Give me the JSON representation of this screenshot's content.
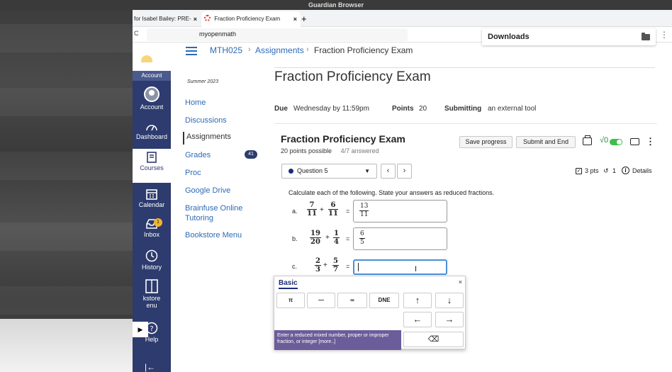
{
  "os": {
    "window_title": "Guardian Browser"
  },
  "tabs": [
    {
      "label": "for Isabel Bailey: PRE-"
    },
    {
      "label": "Fraction Proficiency Exam"
    }
  ],
  "address": {
    "url": "myopenmath"
  },
  "downloads": {
    "label": "Downloads"
  },
  "rail": {
    "account_top": "Account",
    "items": [
      {
        "label": "Account"
      },
      {
        "label": "Dashboard"
      },
      {
        "label": "Courses"
      },
      {
        "label": "Calendar"
      },
      {
        "label": "Inbox",
        "badge": "1"
      },
      {
        "label": "History"
      },
      {
        "label": "kstore",
        "label2": "enu"
      },
      {
        "label": "Help"
      }
    ]
  },
  "breadcrumb": {
    "course": "MTH025",
    "section": "Assignments",
    "current": "Fraction Proficiency Exam"
  },
  "course_nav": {
    "term": "Summer 2023",
    "items": [
      {
        "label": "Home"
      },
      {
        "label": "Discussions"
      },
      {
        "label": "Assignments"
      },
      {
        "label": "Grades",
        "badge": "41"
      },
      {
        "label": "Proc"
      },
      {
        "label": "Google Drive"
      },
      {
        "label": "Brainfuse Online",
        "label2": "Tutoring"
      },
      {
        "label": "Bookstore Menu"
      }
    ]
  },
  "assignment": {
    "title": "Fraction Proficiency Exam",
    "due_label": "Due",
    "due_value": "Wednesday by 11:59pm",
    "points_label": "Points",
    "points_value": "20",
    "submitting_label": "Submitting",
    "submitting_value": "an external tool"
  },
  "exam": {
    "title": "Fraction Proficiency Exam",
    "points_possible": "20 points possible",
    "answered": "4/7 answered",
    "save_label": "Save progress",
    "submit_label": "Submit and End",
    "sqrt_label": "√0",
    "question_label": "Question 5",
    "pts": "3 pts",
    "retries": "1",
    "details": "Details"
  },
  "question": {
    "instruction": "Calculate each of the following. State your answers as reduced fractions.",
    "parts": [
      {
        "letter": "a.",
        "n1": "7",
        "d1": "11",
        "n2": "6",
        "d2": "11",
        "ans_n": "13",
        "ans_d": "11"
      },
      {
        "letter": "b.",
        "n1": "19",
        "d1": "20",
        "n2": "1",
        "d2": "4",
        "ans_n": "6",
        "ans_d": "5"
      },
      {
        "letter": "c.",
        "n1": "2",
        "d1": "3",
        "n2": "5",
        "d2": "7",
        "ans_n": "",
        "ans_d": ""
      }
    ]
  },
  "mathpad": {
    "tab": "Basic",
    "keys": [
      "π",
      "—",
      "∞",
      "DNE"
    ],
    "hint": "Enter a reduced mixed number, proper or improper fraction, or integer [more..]"
  }
}
